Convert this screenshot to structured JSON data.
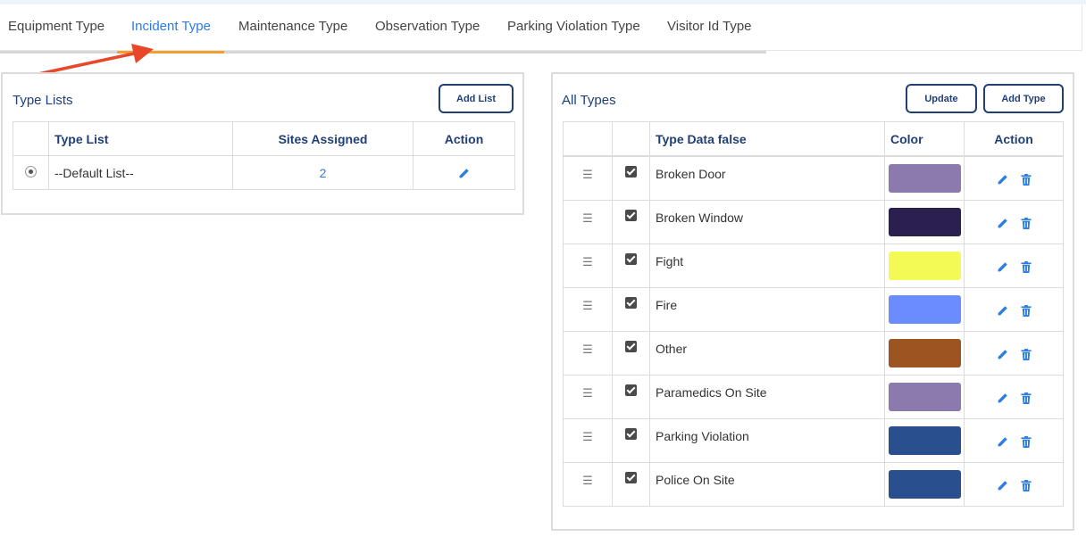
{
  "tabs": [
    {
      "label": "Equipment Type"
    },
    {
      "label": "Incident Type"
    },
    {
      "label": "Maintenance Type"
    },
    {
      "label": "Observation Type"
    },
    {
      "label": "Parking Violation Type"
    },
    {
      "label": "Visitor Id Type"
    }
  ],
  "active_tab": "Incident Type",
  "type_lists": {
    "title": "Type Lists",
    "add_button": "Add List",
    "headers": {
      "type_list": "Type List",
      "sites_assigned": "Sites Assigned",
      "action": "Action"
    },
    "rows": [
      {
        "name": "--Default List--",
        "sites": "2",
        "selected": true
      }
    ]
  },
  "all_types": {
    "title": "All Types",
    "update_button": "Update",
    "add_button": "Add Type",
    "headers": {
      "type_data": "Type Data false",
      "color": "Color",
      "action": "Action"
    },
    "rows": [
      {
        "name": "Broken Door",
        "color": "#8a7aad",
        "checked": true
      },
      {
        "name": "Broken Window",
        "color": "#2a1f4f",
        "checked": true
      },
      {
        "name": "Fight",
        "color": "#f4fa55",
        "checked": true
      },
      {
        "name": "Fire",
        "color": "#6a8cff",
        "checked": true
      },
      {
        "name": "Other",
        "color": "#9c5520",
        "checked": true
      },
      {
        "name": "Paramedics On Site",
        "color": "#8a7aad",
        "checked": true
      },
      {
        "name": "Parking Violation",
        "color": "#2a4f8f",
        "checked": true
      },
      {
        "name": "Police On Site",
        "color": "#2a4f8f",
        "checked": true
      }
    ]
  },
  "colors": {
    "accent": "#2e7de0",
    "navy": "#1f3f75",
    "tab_indicator": "#f0a030",
    "arrow": "#e8472a"
  }
}
